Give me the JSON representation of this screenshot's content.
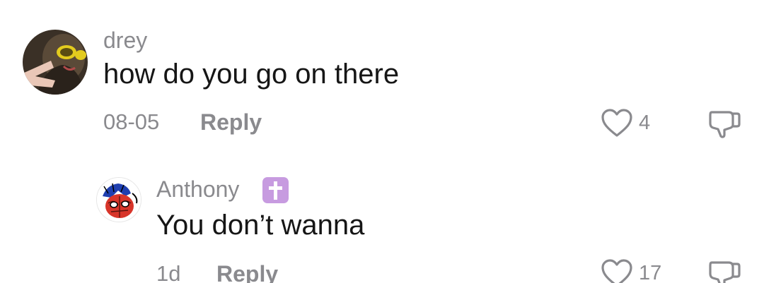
{
  "comments": [
    {
      "username": "drey",
      "text": "how do you go on there",
      "date": "08-05",
      "reply_label": "Reply",
      "like_count": "4",
      "avatar_icon": "profile-photo-avatar"
    },
    {
      "username": "Anthony",
      "badge_icon": "latin-cross-emoji",
      "text": "You don’t wanna",
      "date": "1d",
      "reply_label": "Reply",
      "like_count": "17",
      "avatar_icon": "spider-man-avatar"
    }
  ],
  "colors": {
    "text": "#161616",
    "muted": "#8a8a8e",
    "background": "#ffffff",
    "badge": "#c79be0"
  }
}
